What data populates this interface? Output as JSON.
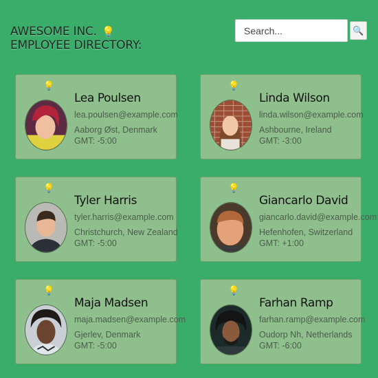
{
  "header": {
    "title_line1": "AWESOME INC.",
    "title_line2": "EMPLOYEE DIRECTORY:",
    "bulb_icon": "💡"
  },
  "search": {
    "placeholder": "Search...",
    "button_icon": "🔍"
  },
  "colors": {
    "background": "#3bad6b",
    "card_background": "#8fbf8c"
  },
  "employees": [
    {
      "name": "Lea Poulsen",
      "email": "lea.poulsen@example.com",
      "location": "Aaborg Øst, Denmark",
      "gmt": "GMT: -5:00",
      "bulb_icon": "💡"
    },
    {
      "name": "Linda Wilson",
      "email": "linda.wilson@example.com",
      "location": "Ashbourne, Ireland",
      "gmt": "GMT: -3:00",
      "bulb_icon": "💡"
    },
    {
      "name": "Tyler Harris",
      "email": "tyler.harris@example.com",
      "location": "Christchurch, New Zealand",
      "gmt": "GMT: -5:00",
      "bulb_icon": "💡"
    },
    {
      "name": "Giancarlo David",
      "email": "giancarlo.david@example.com",
      "location": "Hefenhofen, Switzerland",
      "gmt": "GMT: +1:00",
      "bulb_icon": "💡"
    },
    {
      "name": "Maja Madsen",
      "email": "maja.madsen@example.com",
      "location": "Gjerlev, Denmark",
      "gmt": "GMT: -5:00",
      "bulb_icon": "💡"
    },
    {
      "name": "Farhan Ramp",
      "email": "farhan.ramp@example.com",
      "location": "Oudorp Nh, Netherlands",
      "gmt": "GMT: -6:00",
      "bulb_icon": "💡"
    }
  ]
}
